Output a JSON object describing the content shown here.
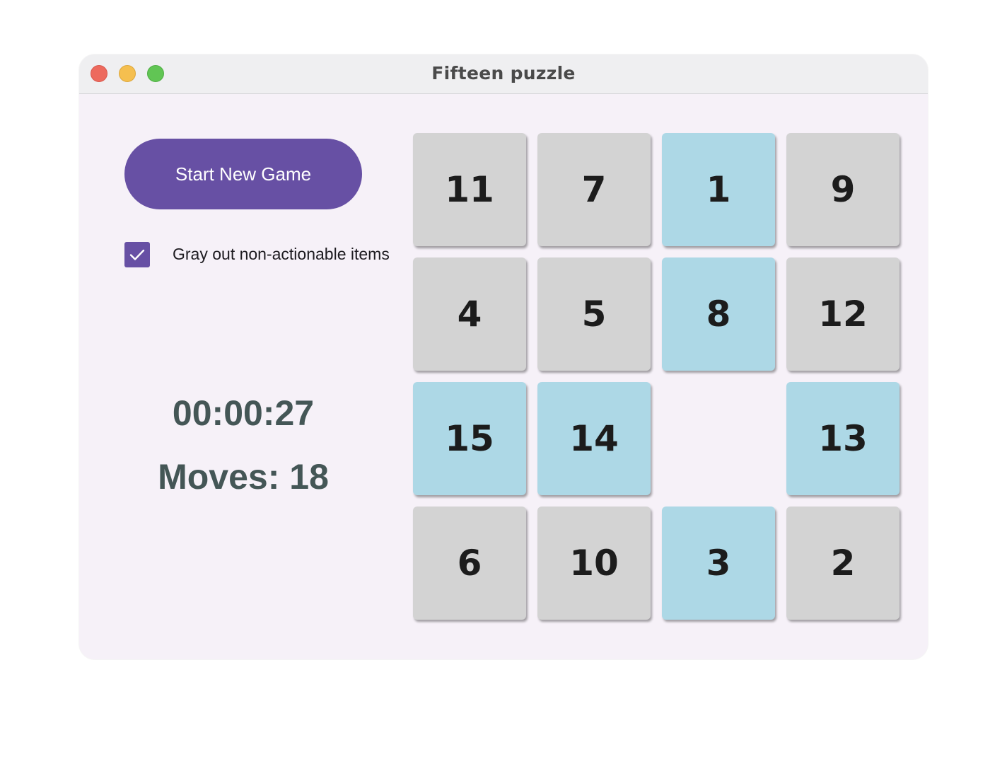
{
  "window": {
    "title": "Fifteen puzzle"
  },
  "controls": {
    "start_label": "Start New Game",
    "checkbox_label": "Gray out non-actionable items",
    "checkbox_checked": true
  },
  "status": {
    "timer": "00:00:27",
    "moves": "Moves: 18"
  },
  "board": {
    "tiles": [
      {
        "label": "11",
        "state": "gray"
      },
      {
        "label": "7",
        "state": "gray"
      },
      {
        "label": "1",
        "state": "blue"
      },
      {
        "label": "9",
        "state": "gray"
      },
      {
        "label": "4",
        "state": "gray"
      },
      {
        "label": "5",
        "state": "gray"
      },
      {
        "label": "8",
        "state": "blue"
      },
      {
        "label": "12",
        "state": "gray"
      },
      {
        "label": "15",
        "state": "blue"
      },
      {
        "label": "14",
        "state": "blue"
      },
      {
        "label": "",
        "state": "empty"
      },
      {
        "label": "13",
        "state": "blue"
      },
      {
        "label": "6",
        "state": "gray"
      },
      {
        "label": "10",
        "state": "gray"
      },
      {
        "label": "3",
        "state": "blue"
      },
      {
        "label": "2",
        "state": "gray"
      }
    ]
  },
  "colors": {
    "accent": "#6750a4",
    "tile_gray": "#d3d3d3",
    "tile_actionable": "#add8e6",
    "status_text": "#445656"
  }
}
